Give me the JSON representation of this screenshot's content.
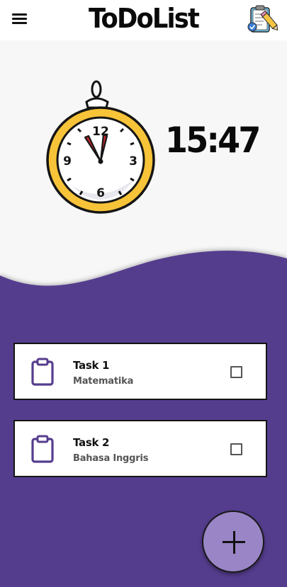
{
  "header": {
    "title": "ToDoList",
    "menu_icon": "hamburger-menu-icon",
    "logo_icon": "clipboard-checklist-icon"
  },
  "clock": {
    "time": "15:47",
    "icon": "stopwatch-icon",
    "dial_numbers": [
      "12",
      "3",
      "6",
      "9"
    ]
  },
  "tasks": [
    {
      "title": "Task 1",
      "subject": "Matematika",
      "icon": "clipboard-icon",
      "checked": false
    },
    {
      "title": "Task 2",
      "subject": "Bahasa Inggris",
      "icon": "clipboard-icon",
      "checked": false
    }
  ],
  "fab": {
    "icon": "plus-icon"
  },
  "colors": {
    "purple_background": "#553d8e",
    "fab": "#9a85c6",
    "clock_rim": "#f7c338",
    "clock_hands": "#c1272d",
    "task_icon": "#553d8e"
  }
}
